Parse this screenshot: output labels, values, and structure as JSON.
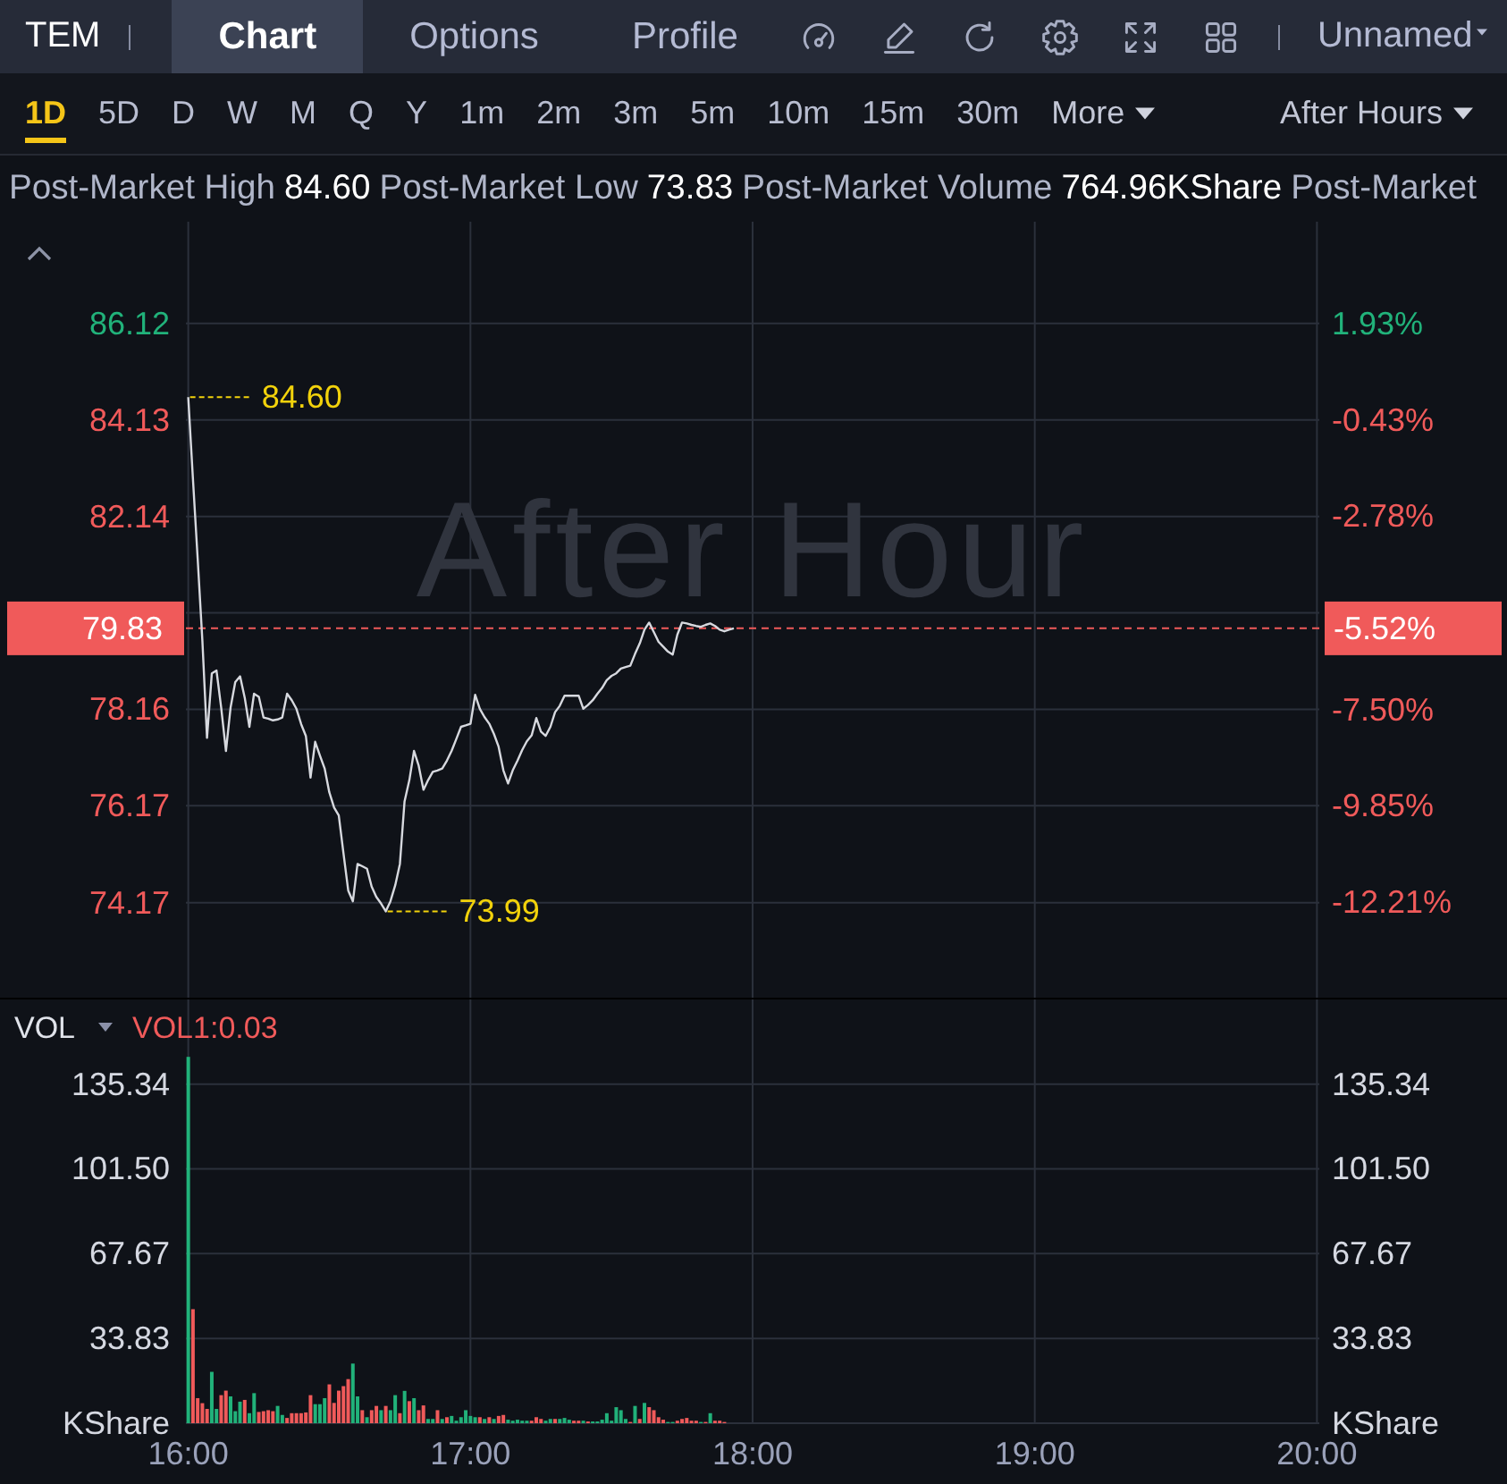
{
  "header": {
    "symbol": "TEM",
    "tabs": [
      {
        "label": "Chart",
        "selected": true
      },
      {
        "label": "Options",
        "selected": false
      },
      {
        "label": "Profile",
        "selected": false
      }
    ],
    "layout_name": "Unnamed"
  },
  "timeframes": {
    "items": [
      {
        "label": "1D",
        "selected": true
      },
      {
        "label": "5D",
        "selected": false
      },
      {
        "label": "D",
        "selected": false
      },
      {
        "label": "W",
        "selected": false
      },
      {
        "label": "M",
        "selected": false
      },
      {
        "label": "Q",
        "selected": false
      },
      {
        "label": "Y",
        "selected": false
      },
      {
        "label": "1m",
        "selected": false
      },
      {
        "label": "2m",
        "selected": false
      },
      {
        "label": "3m",
        "selected": false
      },
      {
        "label": "5m",
        "selected": false
      },
      {
        "label": "10m",
        "selected": false
      },
      {
        "label": "15m",
        "selected": false
      },
      {
        "label": "30m",
        "selected": false
      }
    ],
    "more": "More",
    "session": "After Hours"
  },
  "stats": [
    {
      "label": "Post-Market High",
      "value": "84.60"
    },
    {
      "label": "Post-Market Low",
      "value": "73.83"
    },
    {
      "label": "Post-Market Volume",
      "value": "764.96KShare"
    },
    {
      "label": "Post-Market"
    }
  ],
  "price_chart": {
    "session_label": "After Hour",
    "change_tag": "-5.52%",
    "chart_data": {
      "type": "line",
      "grid": true,
      "categories": [
        null,
        null,
        null,
        null,
        null,
        null,
        null,
        null,
        null,
        null,
        null,
        null,
        null,
        null,
        null,
        null,
        null,
        null,
        null,
        null,
        null,
        null,
        null,
        null,
        null,
        null,
        null,
        null,
        null,
        null,
        null,
        null,
        null,
        null,
        null,
        null,
        null,
        null,
        null,
        null,
        null,
        null,
        null,
        null,
        null,
        null,
        null,
        null,
        null,
        null,
        null,
        null,
        null,
        null,
        null,
        null,
        null,
        null,
        null,
        null,
        null,
        null,
        null,
        null,
        null,
        null,
        null,
        null,
        null,
        null,
        null,
        null,
        null,
        null,
        null,
        null,
        null,
        null,
        null,
        null,
        null,
        null,
        null,
        null,
        null,
        null,
        null,
        null,
        null,
        null,
        null,
        null,
        null,
        null,
        null,
        null,
        null,
        null,
        null,
        null,
        null,
        null,
        null,
        null,
        null,
        null,
        null,
        null,
        null,
        null,
        null,
        null,
        null,
        null,
        null,
        null,
        null,
        null,
        null,
        null,
        null,
        null,
        null,
        null,
        null,
        null,
        null,
        null,
        null,
        null,
        null,
        null,
        null,
        null,
        null,
        null,
        null,
        null,
        null,
        null,
        null,
        null,
        null,
        null,
        null,
        null,
        null,
        null,
        null,
        null,
        null,
        null,
        null,
        null,
        null,
        null,
        null,
        null,
        null,
        null,
        null,
        null,
        null,
        null,
        null,
        null,
        null,
        null,
        null,
        null,
        null,
        null,
        null,
        null,
        null,
        null,
        null,
        null,
        null,
        null,
        null,
        null,
        null,
        null,
        null,
        null,
        null,
        null,
        null,
        null,
        null,
        null,
        null,
        null,
        null,
        null,
        null,
        null,
        null,
        null,
        null,
        null,
        null,
        null,
        null,
        null,
        null,
        null,
        null,
        null,
        null,
        null,
        null,
        null,
        null,
        null,
        null,
        null,
        null,
        null,
        null,
        null,
        null,
        null,
        null,
        null,
        null,
        null,
        null,
        null,
        null,
        null,
        null,
        null,
        null,
        null,
        null,
        null,
        null,
        null,
        null
      ],
      "values": [
        84.6,
        82.93,
        81.25,
        79.58,
        77.57,
        78.9,
        78.96,
        78.2,
        77.3,
        78.2,
        78.72,
        78.84,
        78.4,
        77.8,
        78.48,
        78.42,
        77.99,
        77.97,
        77.93,
        77.95,
        77.99,
        78.48,
        78.35,
        78.17,
        77.85,
        77.61,
        76.75,
        77.49,
        77.2,
        76.94,
        76.45,
        76.13,
        75.97,
        75.2,
        74.42,
        74.2,
        74.97,
        74.92,
        74.87,
        74.5,
        74.29,
        74.15,
        73.99,
        74.2,
        74.53,
        74.97,
        76.26,
        76.7,
        77.3,
        77.0,
        76.5,
        76.7,
        76.87,
        76.9,
        76.94,
        77.1,
        77.3,
        77.55,
        77.8,
        77.83,
        77.86,
        78.46,
        78.17,
        78.0,
        77.86,
        77.65,
        77.39,
        76.9,
        76.63,
        76.9,
        77.1,
        77.32,
        77.5,
        77.62,
        77.98,
        77.7,
        77.61,
        77.8,
        78.1,
        78.23,
        78.44,
        78.44,
        78.44,
        78.44,
        78.17,
        78.25,
        78.35,
        78.48,
        78.6,
        78.76,
        78.85,
        78.9,
        79.0,
        79.03,
        79.06,
        79.3,
        79.52,
        79.8,
        79.95,
        79.75,
        79.55,
        79.45,
        79.35,
        79.29,
        79.7,
        79.95,
        79.93,
        79.9,
        79.88,
        79.86,
        79.9,
        79.93,
        79.88,
        79.8,
        79.77,
        79.8,
        79.83,
        null,
        null,
        null,
        null,
        null,
        null,
        null,
        null,
        null,
        null,
        null,
        null,
        null,
        null,
        null,
        null,
        null,
        null,
        null,
        null,
        null,
        null,
        null,
        null,
        null,
        null,
        null,
        null,
        null,
        null,
        null,
        null,
        null,
        null,
        null,
        null,
        null,
        null,
        null,
        null,
        null,
        null,
        null,
        null,
        null,
        null,
        null,
        null,
        null,
        null,
        null,
        null,
        null,
        null,
        null,
        null,
        null,
        null,
        null,
        null,
        null,
        null,
        null,
        null,
        null,
        null,
        null,
        null,
        null,
        null,
        null,
        null,
        null,
        null,
        null,
        null,
        null,
        null,
        null,
        null,
        null,
        null,
        null,
        null,
        null,
        null,
        null,
        null,
        null,
        null,
        null,
        null,
        null,
        null,
        null,
        null,
        null,
        null,
        null,
        null,
        null,
        null,
        null,
        null,
        null,
        null,
        null,
        null,
        null,
        null,
        null,
        null,
        null,
        null,
        null,
        null,
        null,
        null,
        null,
        null,
        null,
        null,
        null,
        null
      ],
      "ylim": [
        72.21,
        88.22
      ],
      "yticks": [
        {
          "value": 86.12,
          "label": "86.12"
        },
        {
          "value": 84.13,
          "label": "84.13"
        },
        {
          "value": 82.14,
          "label": "82.14"
        },
        {
          "value": 78.16,
          "label": "78.16"
        },
        {
          "value": 76.17,
          "label": "76.17"
        },
        {
          "value": 74.17,
          "label": "74.17"
        }
      ],
      "y2lim": [
        -14.54,
        4.41
      ],
      "y2ticks": [
        {
          "value": 1.93,
          "label": "1.93%"
        },
        {
          "value": -0.43,
          "label": "-0.43%"
        },
        {
          "value": -2.78,
          "label": "-2.78%"
        },
        {
          "value": -7.5,
          "label": "-7.50%"
        },
        {
          "value": -9.85,
          "label": "-9.85%"
        },
        {
          "value": -12.21,
          "label": "-12.21%"
        }
      ],
      "ref_lines": [
        {
          "axis": "y",
          "value": 79.83,
          "label": "79.83"
        }
      ],
      "annotations": [
        "84.60",
        "73.99"
      ]
    }
  },
  "volume": {
    "indicator": "VOL",
    "reading": "VOL1:0.03",
    "chart_data": {
      "type": "bar",
      "grid": true,
      "categories": [
        "16:00",
        null,
        null,
        null,
        null,
        null,
        null,
        null,
        null,
        null,
        null,
        null,
        null,
        null,
        null,
        null,
        null,
        null,
        null,
        null,
        null,
        null,
        null,
        null,
        null,
        null,
        null,
        null,
        null,
        null,
        null,
        null,
        null,
        null,
        null,
        null,
        null,
        null,
        null,
        null,
        null,
        null,
        null,
        null,
        null,
        null,
        null,
        null,
        null,
        null,
        null,
        null,
        null,
        null,
        null,
        null,
        null,
        null,
        null,
        null,
        "17:00",
        null,
        null,
        null,
        null,
        null,
        null,
        null,
        null,
        null,
        null,
        null,
        null,
        null,
        null,
        null,
        null,
        null,
        null,
        null,
        null,
        null,
        null,
        null,
        null,
        null,
        null,
        null,
        null,
        null,
        null,
        null,
        null,
        null,
        null,
        null,
        null,
        null,
        null,
        null,
        null,
        null,
        null,
        null,
        null,
        null,
        null,
        null,
        null,
        null,
        null,
        null,
        null,
        null,
        null,
        null,
        null,
        null,
        null,
        null,
        "18:00",
        null,
        null,
        null,
        null,
        null,
        null,
        null,
        null,
        null,
        null,
        null,
        null,
        null,
        null,
        null,
        null,
        null,
        null,
        null,
        null,
        null,
        null,
        null,
        null,
        null,
        null,
        null,
        null,
        null,
        null,
        null,
        null,
        null,
        null,
        null,
        null,
        null,
        null,
        null,
        null,
        null,
        null,
        null,
        null,
        null,
        null,
        null,
        null,
        null,
        null,
        null,
        null,
        null,
        null,
        null,
        null,
        null,
        null,
        null,
        "19:00",
        null,
        null,
        null,
        null,
        null,
        null,
        null,
        null,
        null,
        null,
        null,
        null,
        null,
        null,
        null,
        null,
        null,
        null,
        null,
        null,
        null,
        null,
        null,
        null,
        null,
        null,
        null,
        null,
        null,
        null,
        null,
        null,
        null,
        null,
        null,
        null,
        null,
        null,
        null,
        null,
        null,
        null,
        null,
        null,
        null,
        null,
        null,
        null,
        null,
        null,
        null,
        null,
        null,
        null,
        null,
        null,
        null,
        null,
        null,
        "20:00"
      ],
      "series": [
        {
          "color": "#21b27a",
          "values": [
            146.2,
            null,
            null,
            null,
            null,
            20.5,
            5.7,
            null,
            null,
            10.7,
            4.8,
            8.6,
            null,
            4,
            12,
            null,
            null,
            null,
            null,
            6.9,
            3.3,
            null,
            null,
            null,
            null,
            null,
            null,
            7.6,
            7.6,
            10,
            null,
            null,
            null,
            null,
            null,
            23.8,
            10.7,
            null,
            2.4,
            null,
            null,
            5.2,
            null,
            5.2,
            11.2,
            null,
            12.9,
            null,
            10,
            null,
            null,
            1.7,
            1.7,
            null,
            1.7,
            null,
            2.9,
            1,
            2.4,
            5.2,
            2.9,
            2.4,
            null,
            1.7,
            null,
            1.7,
            null,
            null,
            1.4,
            1,
            1.4,
            1,
            1,
            null,
            null,
            null,
            1,
            1.7,
            null,
            1.7,
            2.1,
            1.4,
            null,
            null,
            1,
            null,
            0.7,
            0.7,
            1.4,
            4,
            1,
            6.4,
            5.2,
            1.7,
            null,
            6.9,
            null,
            8.1,
            null,
            null,
            null,
            null,
            0.5,
            0.5,
            null,
            null,
            null,
            null,
            null,
            0.5,
            null,
            4,
            null,
            null,
            null,
            null,
            null,
            null,
            null,
            null,
            null,
            null,
            null,
            null,
            null,
            null,
            null,
            null,
            null,
            null,
            null,
            null,
            null,
            null,
            null,
            null,
            null,
            null,
            null,
            null,
            null,
            null,
            null,
            null,
            null,
            null,
            null,
            null,
            null,
            null,
            null,
            null,
            null,
            null,
            null,
            null,
            null,
            null,
            null,
            null,
            null,
            null,
            null,
            null,
            null,
            null,
            null,
            null,
            null,
            null,
            null,
            null,
            null,
            null,
            null,
            null,
            null,
            null,
            null,
            null,
            null,
            null,
            null,
            null,
            null,
            null,
            null,
            null,
            null,
            null,
            null,
            null,
            null,
            null,
            null,
            null,
            null,
            null,
            null,
            null,
            null,
            null,
            null,
            null,
            null,
            null,
            null,
            null,
            null,
            null,
            null,
            null,
            null,
            null,
            null,
            null,
            null,
            null,
            null,
            null,
            null,
            null,
            null,
            null,
            null,
            null,
            null,
            null,
            null,
            null,
            null,
            null,
            null,
            null,
            null,
            null,
            null,
            null,
            null,
            null,
            null
          ]
        },
        {
          "color": "#f05a5a",
          "values": [
            null,
            45.5,
            10,
            8,
            5.7,
            null,
            null,
            11.2,
            13,
            null,
            null,
            null,
            9.3,
            null,
            null,
            4.5,
            4.8,
            5.2,
            4.8,
            null,
            null,
            2.1,
            4,
            4,
            4,
            4.3,
            11.2,
            null,
            null,
            null,
            15.5,
            8.1,
            13,
            14.8,
            17.6,
            null,
            null,
            5.2,
            null,
            5.2,
            6.9,
            null,
            6.9,
            null,
            null,
            4,
            null,
            8.8,
            null,
            5.2,
            7.1,
            null,
            null,
            5.2,
            null,
            2.4,
            null,
            null,
            null,
            null,
            null,
            null,
            2.4,
            null,
            2.4,
            null,
            2.9,
            3.3,
            null,
            null,
            null,
            null,
            null,
            1,
            2.4,
            1.7,
            null,
            null,
            1.7,
            null,
            null,
            null,
            1,
            1,
            null,
            0.7,
            null,
            null,
            null,
            null,
            null,
            null,
            null,
            null,
            0.5,
            null,
            1.7,
            null,
            6.4,
            5.2,
            2.4,
            1.4,
            null,
            null,
            1,
            1.7,
            2.1,
            1,
            1,
            null,
            0.5,
            null,
            1,
            1,
            0.5,
            null,
            null,
            null,
            null,
            null,
            null,
            null,
            null,
            null,
            null,
            null,
            null,
            null,
            null,
            null,
            null,
            null,
            null,
            null,
            null,
            null,
            null,
            null,
            null,
            null,
            null,
            null,
            null,
            null,
            null,
            null,
            null,
            null,
            null,
            null,
            null,
            null,
            null,
            null,
            null,
            null,
            null,
            null,
            null,
            null,
            null,
            null,
            null,
            null,
            null,
            null,
            null,
            null,
            null,
            null,
            null,
            null,
            null,
            null,
            null,
            null,
            null,
            null,
            null,
            null,
            null,
            null,
            null,
            null,
            null,
            null,
            null,
            null,
            null,
            null,
            null,
            null,
            null,
            null,
            null,
            null,
            null,
            null,
            null,
            null,
            null,
            null,
            null,
            null,
            null,
            null,
            null,
            null,
            null,
            null,
            null,
            null,
            null,
            null,
            null,
            null,
            null,
            null,
            null,
            null,
            null,
            null,
            null,
            null,
            null,
            null,
            null,
            null,
            null,
            null,
            null,
            null,
            null,
            null,
            null,
            null,
            null,
            null,
            null,
            null,
            null
          ]
        }
      ],
      "ylim": [
        0,
        169.1
      ],
      "yticks": [
        {
          "value": 135.34,
          "label": "135.34"
        },
        {
          "value": 101.5,
          "label": "101.50"
        },
        {
          "value": 67.67,
          "label": "67.67"
        },
        {
          "value": 33.83,
          "label": "33.83"
        },
        {
          "value": 0,
          "label": "KShare"
        }
      ],
      "y2lim": [
        0,
        169.1
      ],
      "y2ticks": [
        {
          "value": 135.34,
          "label": "135.34"
        },
        {
          "value": 101.5,
          "label": "101.50"
        },
        {
          "value": 67.67,
          "label": "67.67"
        },
        {
          "value": 33.83,
          "label": "33.83"
        },
        {
          "value": 0,
          "label": "KShare"
        }
      ]
    }
  }
}
